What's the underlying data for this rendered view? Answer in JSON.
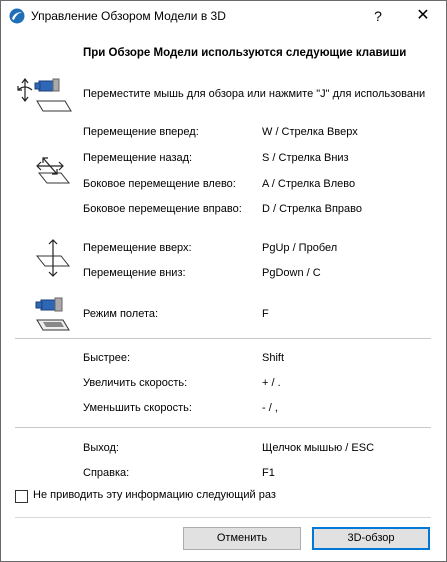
{
  "window": {
    "title": "Управление Обзором Модели в 3D",
    "help_glyph": "?",
    "close_glyph": "✕"
  },
  "heading": "При Обзоре Модели используются следующие клавиши",
  "mouse_hint": "Переместите мышь для обзора или нажмите \"J\" для использовани",
  "movement": [
    {
      "label": "Перемещение вперед:",
      "key": "W / Стрелка Вверх"
    },
    {
      "label": "Перемещение назад:",
      "key": "S / Стрелка Вниз"
    },
    {
      "label": "Боковое перемещение влево:",
      "key": "A / Стрелка Влево"
    },
    {
      "label": "Боковое перемещение вправо:",
      "key": "D / Стрелка Вправо"
    }
  ],
  "vertical": [
    {
      "label": "Перемещение вверх:",
      "key": "PgUp / Пробел"
    },
    {
      "label": "Перемещение вниз:",
      "key": "PgDown / C"
    }
  ],
  "flight": {
    "label": "Режим полета:",
    "key": "F"
  },
  "speed": [
    {
      "label": "Быстрее:",
      "key": "Shift"
    },
    {
      "label": "Увеличить скорость:",
      "key": "+ / ."
    },
    {
      "label": "Уменьшить скорость:",
      "key": "- / ,"
    }
  ],
  "exit": [
    {
      "label": "Выход:",
      "key": "Щелчок мышью / ESC"
    },
    {
      "label": "Справка:",
      "key": "F1"
    }
  ],
  "checkbox": {
    "label": "Не приводить эту информацию следующий раз",
    "checked": false
  },
  "buttons": {
    "cancel": "Отменить",
    "ok": "3D-обзор"
  }
}
